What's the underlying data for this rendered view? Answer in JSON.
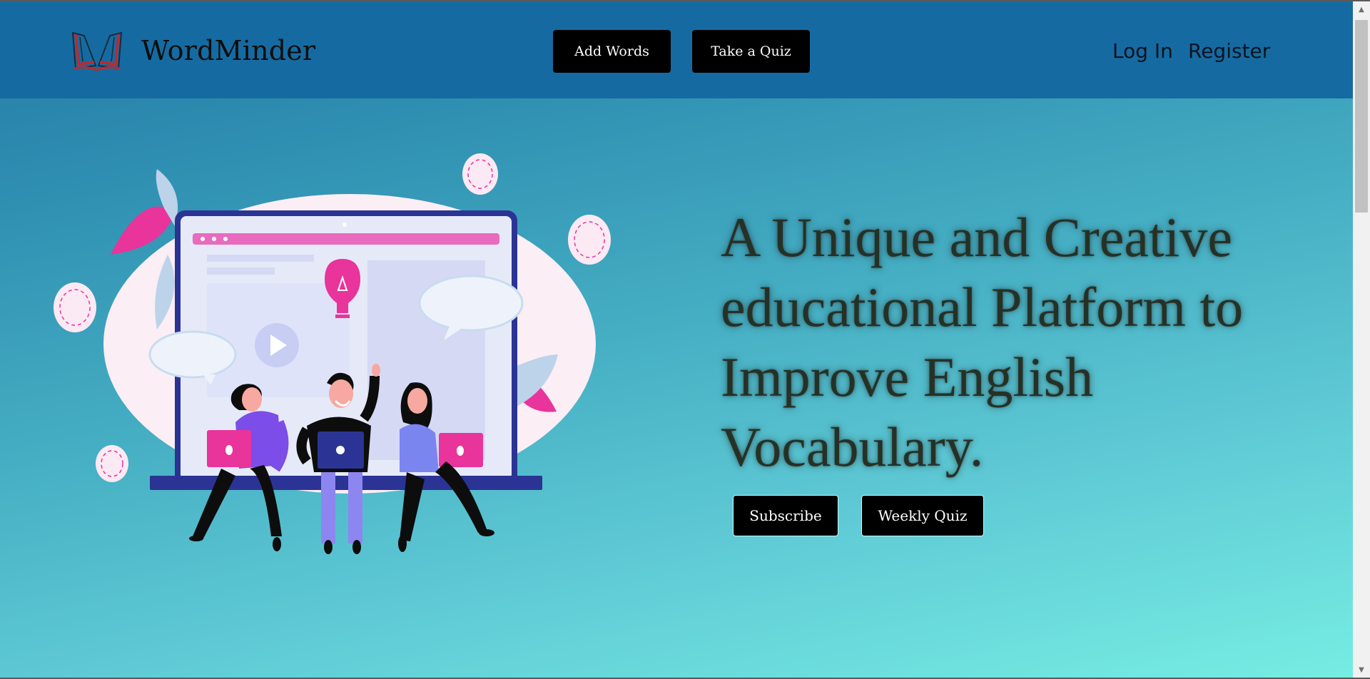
{
  "brand": {
    "name": "WordMinder",
    "logo_icon": "open-book-icon"
  },
  "nav": {
    "add_words_label": "Add Words",
    "take_quiz_label": "Take a Quiz",
    "login_label": "Log In",
    "register_label": "Register"
  },
  "hero": {
    "headline": "A Unique and Creative educational Platform to Improve English Vocabulary.",
    "subscribe_label": "Subscribe",
    "weekly_quiz_label": "Weekly Quiz",
    "illustration": "people-studying-with-laptops-illustration"
  },
  "scrollbar": {
    "up_icon": "▲",
    "down_icon": "▼"
  },
  "colors": {
    "navbar": "#156ba1",
    "gradient_top": "#2579a6",
    "gradient_bottom": "#76ece2",
    "button_bg": "#000000",
    "accent_pink": "#e8349b",
    "accent_purple": "#7c4de8",
    "accent_navy": "#2b3494"
  }
}
